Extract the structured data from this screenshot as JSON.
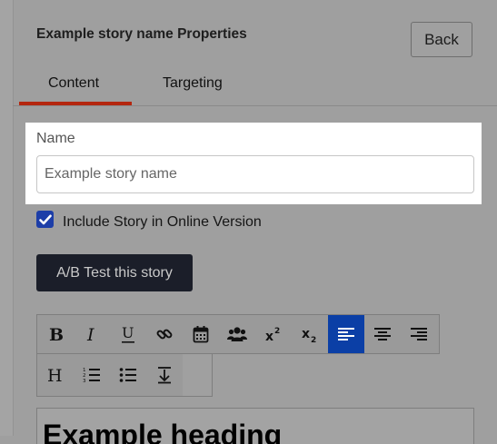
{
  "header": {
    "title": "Example story name Properties",
    "back_label": "Back"
  },
  "tabs": [
    {
      "label": "Content",
      "active": true
    },
    {
      "label": "Targeting",
      "active": false
    }
  ],
  "form": {
    "name_label": "Name",
    "name_placeholder": "Example story name",
    "include_online_label": "Include Story in Online Version",
    "include_online_checked": true,
    "ab_test_label": "A/B Test this story"
  },
  "toolbar": {
    "row1": [
      "bold-icon",
      "italic-icon",
      "underline-icon",
      "link-icon",
      "calendar-icon",
      "users-icon",
      "superscript-icon",
      "subscript-icon",
      "align-left-icon",
      "align-center-icon",
      "align-right-icon"
    ],
    "row2": [
      "heading-icon",
      "ordered-list-icon",
      "unordered-list-icon",
      "insert-break-icon"
    ],
    "active": "align-left-icon"
  },
  "editor": {
    "heading_text": "Example heading"
  },
  "colors": {
    "accent": "#b4270f",
    "active_button": "#0b3fa6",
    "dark_button": "#1b1e29"
  }
}
